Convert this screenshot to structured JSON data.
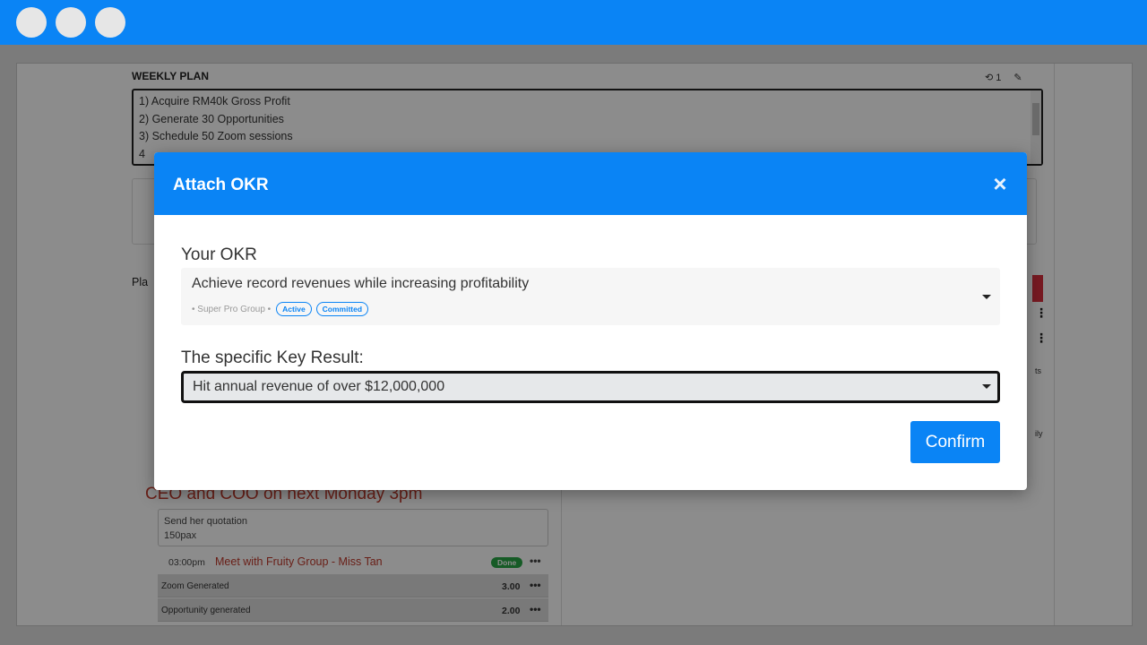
{
  "window": {
    "controls": [
      "close",
      "minimize",
      "maximize"
    ]
  },
  "weekly_plan": {
    "title": "WEEKLY PLAN",
    "history_count": "1",
    "lines": [
      "1) Acquire RM40k Gross Profit",
      "2) Generate 30 Opportunities",
      "3) Schedule 50 Zoom sessions",
      "4"
    ]
  },
  "background": {
    "plan_label": "Pla",
    "partial_heading": "CEO and COO on next Monday 3pm",
    "note_lines": [
      "Send her quotation",
      "150pax"
    ],
    "meeting": {
      "time": "03:00pm",
      "title": "Meet with Fruity Group - Miss Tan",
      "status": "Done"
    },
    "metrics": [
      {
        "label": "Zoom Generated",
        "value": "3.00"
      },
      {
        "label": "Opportunity generated",
        "value": "2.00"
      }
    ],
    "right_stub_a": "ts",
    "right_stub_b": "ily"
  },
  "modal": {
    "title": "Attach OKR",
    "okr_label": "Your OKR",
    "okr_selected": "Achieve record revenues while increasing profitability",
    "okr_group": "• Super Pro Group •",
    "okr_status": "Active",
    "okr_type": "Committed",
    "kr_label": "The specific Key Result:",
    "kr_selected": "Hit annual revenue of over $12,000,000",
    "confirm_label": "Confirm"
  },
  "colors": {
    "primary": "#0a84f5",
    "danger": "#d9303e",
    "success": "#28a745"
  }
}
